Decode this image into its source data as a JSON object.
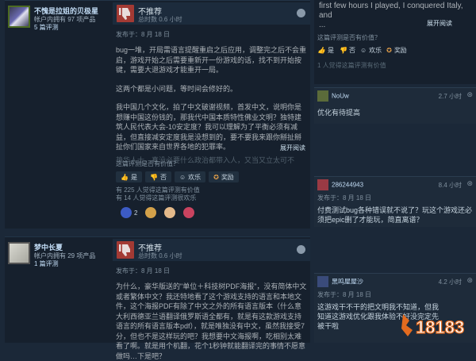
{
  "review1": {
    "author_name": "不愧是拉姐的贝极星",
    "author_products": "帐户内拥有 97 项产品",
    "author_reviews": "5 篇评测",
    "verdict": "不推荐",
    "hours": "总时数 0.6 小时",
    "posted": "发布于：8 月 18 日",
    "body_p1": "bug一堆，开局需语言提醒重启之后应用，调整完之后不会重启，游戏开始之后需要重新开一份游戏的话，找不到开始按键，需要大退游戏才能重开一局。",
    "body_p2": "这两个都是小问题，等时间会修好的。",
    "body_p3": "我中国几个文化，拍了中文破谢视频，首发中文，说明你是想赚中国这份钱的，那我代中国本质特性佛业文明？独特建筑人民代表大会-10安定度？我可以理解为了平衡必须有减益，但直接减安定度我是没想到的，要不要我来跟你掰扯掰扯你们国家来自世界各地的犯罪率。",
    "body_fade": "艳华人士，真没必要什么政治都带入人，又当又立太可不似。",
    "read_more": "展开阅读",
    "helpful_q": "这篇评测是否有价值？",
    "btn_yes": "是",
    "btn_no": "否",
    "btn_funny": "欢乐",
    "btn_award": "奖励",
    "stat1": "有 225 人觉得这篇评测有价值",
    "stat2": "有 14 人觉得这篇评测很欢乐",
    "emoji_count": "2"
  },
  "review2": {
    "author_name": "梦中长夏",
    "author_products": "帐户内拥有 29 项产品",
    "author_reviews": "1 篇评测",
    "verdict": "不推荐",
    "hours": "总时数 0.6 小时",
    "posted": "发布于：8 月 18 日",
    "body_p1": "为什么，豪华版送的\"单位＋科技树PDF海报\"，没有简体中文或者繁体中文？我还特地看了这个游戏支持的语言和本地文件，这个海报PDF有除了中文之外的所有语言版本（什么意大利西德亚兰语翻译俄罗斯语全都有，就是有这款游戏支持语言的所有语言版本pdf），就是唯独没有中文，虽然我接受7分，但也不是这样玩的吧？我想要中文海报啊，吃相别太难看了啊。就是用个机翻，花个1秒钟就能翻译完的事情不愿意做吗…下是吧？"
  },
  "right": {
    "top_text_1": "first few hours I played, I conquered Italy, and",
    "top_text_2": "...",
    "read_more": "展开阅读",
    "helpful_q": "这篇评测是否有价值？",
    "yes": "是",
    "no": "否",
    "funny": "欢乐",
    "award": "奖励",
    "stat": "1 人觉得这篇评测有价值",
    "c1_name": "NoUw",
    "c1_time": "2.7 小时",
    "c1_text": "优化有待提高",
    "c2_name": "286244943",
    "c2_time": "8.4 小时",
    "c2_posted": "发布于：8 月 18 日",
    "c2_text": "付费测试bug各种错误就不说了？玩这个游戏还必须把epic删了才能玩，简直离谱？",
    "c3_name": "黑鸣屋屋沙",
    "c3_time": "4.2 小时",
    "c3_posted": "发布于：8 月 18 日",
    "c3_text": "这游戏干不干的把文明我不知道，但我知道这游戏优化跟我体验不好没完定先被干啦"
  },
  "watermark": "18183"
}
